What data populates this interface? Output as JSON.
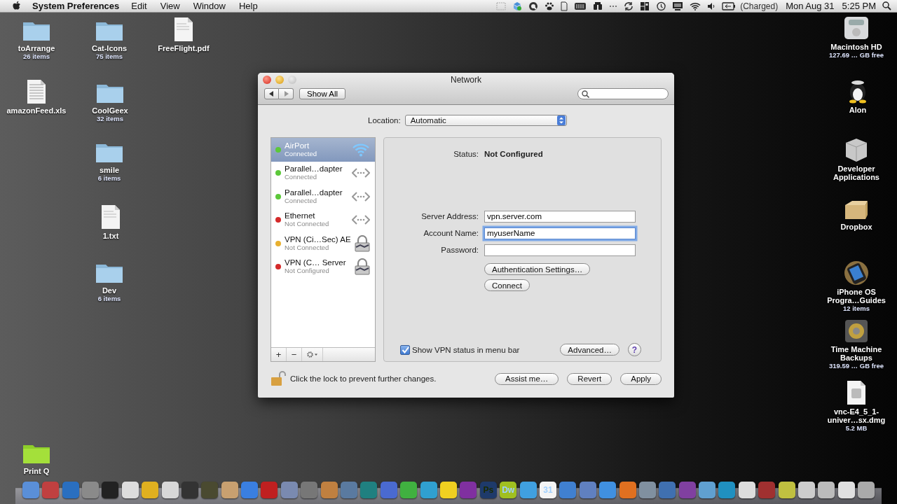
{
  "menu_bar": {
    "app_name": "System Preferences",
    "menus": [
      "Edit",
      "View",
      "Window",
      "Help"
    ],
    "battery_status": "(Charged)",
    "date": "Mon Aug 31",
    "time": "5:25 PM"
  },
  "desktop_icons": [
    {
      "kind": "folder",
      "name": "toArrange",
      "info": "26 items"
    },
    {
      "kind": "folder",
      "name": "Cat-Icons",
      "info": "75 items"
    },
    {
      "kind": "document",
      "name": "FreeFlight.pdf"
    },
    {
      "kind": "spreadsheet",
      "name": "amazonFeed.xls"
    },
    {
      "kind": "folder",
      "name": "CoolGeex",
      "info": "32 items"
    },
    {
      "kind": "folder",
      "name": "smile",
      "info": "6 items"
    },
    {
      "kind": "document",
      "name": "1.txt"
    },
    {
      "kind": "folder",
      "name": "Dev",
      "info": "6 items"
    },
    {
      "kind": "drive",
      "name": "Macintosh HD",
      "info": "127.69 … GB free"
    },
    {
      "kind": "penguin",
      "name": "Alon"
    },
    {
      "kind": "cube",
      "name": "Developer Applications"
    },
    {
      "kind": "box",
      "name": "Dropbox"
    },
    {
      "kind": "phone",
      "name": "iPhone OS Progra…Guides",
      "info": "12 items"
    },
    {
      "kind": "backup",
      "name": "Time Machine Backups",
      "info": "319.59 … GB free"
    },
    {
      "kind": "diskimage",
      "name": "vnc-E4_5_1-univer…sx.dmg",
      "info": "5.2 MB"
    },
    {
      "kind": "greenfolder",
      "name": "Print Q"
    }
  ],
  "window": {
    "title": "Network",
    "show_all": "Show All"
  },
  "location": {
    "label": "Location:",
    "value": "Automatic"
  },
  "services": [
    {
      "name": "AirPort",
      "status": "Connected",
      "color": "#5cc83a",
      "kind": "wifi",
      "selected": true
    },
    {
      "name": "Parallel…dapter",
      "status": "Connected",
      "color": "#5cc83a",
      "kind": "wired",
      "selected": false
    },
    {
      "name": "Parallel…dapter",
      "status": "Connected",
      "color": "#5cc83a",
      "kind": "wired",
      "selected": false
    },
    {
      "name": "Ethernet",
      "status": "Not Connected",
      "color": "#d42a2a",
      "kind": "wired",
      "selected": false
    },
    {
      "name": "VPN (Ci…Sec) AE",
      "status": "Not Connected",
      "color": "#e8b030",
      "kind": "vpn",
      "selected": false
    },
    {
      "name": "VPN (C… Server",
      "status": "Not Configured",
      "color": "#d42a2a",
      "kind": "vpn",
      "selected": false
    }
  ],
  "list_buttons": [
    "+",
    "−"
  ],
  "detail": {
    "status_label": "Status:",
    "status_value": "Not Configured",
    "fields": [
      {
        "label": "Server Address:",
        "value": "vpn.server.com",
        "focused": false
      },
      {
        "label": "Account Name:",
        "value": "myuserName",
        "focused": true
      },
      {
        "label": "Password:",
        "focused": false
      }
    ],
    "buttons": [
      "Authentication Settings…",
      "Connect"
    ],
    "show_vpn_status": {
      "label": "Show VPN status in menu bar",
      "checked": true
    },
    "advanced": "Advanced…",
    "help": "?"
  },
  "footer": {
    "lock_text": "Click the lock to prevent further changes.",
    "buttons": [
      "Assist me…",
      "Revert",
      "Apply"
    ]
  },
  "dock": [
    {
      "kind": "app",
      "color": "#5a8fd8"
    },
    {
      "kind": "app",
      "color": "#c04040"
    },
    {
      "kind": "app",
      "color": "#2a6fc0"
    },
    {
      "kind": "app",
      "color": "#8a8a8a"
    },
    {
      "kind": "app",
      "color": "#222222"
    },
    {
      "kind": "app",
      "color": "#dddddd"
    },
    {
      "kind": "app",
      "color": "#e0b020"
    },
    {
      "kind": "app",
      "color": "#d8d8d8"
    },
    {
      "kind": "app",
      "color": "#333333"
    },
    {
      "kind": "app",
      "color": "#4a4a30"
    },
    {
      "kind": "app",
      "color": "#c8a070"
    },
    {
      "kind": "app",
      "color": "#3a7fe0"
    },
    {
      "kind": "app",
      "color": "#c02020"
    },
    {
      "kind": "app",
      "color": "#7a8ab0"
    },
    {
      "kind": "app",
      "color": "#777777"
    },
    {
      "kind": "app",
      "color": "#c08040"
    },
    {
      "kind": "app",
      "color": "#5a7aa0"
    },
    {
      "kind": "app",
      "color": "#208080"
    },
    {
      "kind": "app",
      "color": "#4a6ad0"
    },
    {
      "kind": "app",
      "color": "#40b040"
    },
    {
      "kind": "app",
      "color": "#30a0d0"
    },
    {
      "kind": "app",
      "color": "#f0d020"
    },
    {
      "kind": "app",
      "color": "#8030a0"
    },
    {
      "kind": "label",
      "color": "#1e3a6a",
      "label": "Ps"
    },
    {
      "kind": "label",
      "color": "#a0c020",
      "label": "Dw"
    },
    {
      "kind": "app",
      "color": "#40a0e0"
    },
    {
      "kind": "label",
      "color": "#f4f4f4",
      "label": "31"
    },
    {
      "kind": "app",
      "color": "#4080d0"
    },
    {
      "kind": "app",
      "color": "#6080c0"
    },
    {
      "kind": "app",
      "color": "#4090e0"
    },
    {
      "kind": "app",
      "color": "#e07020"
    },
    {
      "kind": "app",
      "color": "#8090a0"
    },
    {
      "kind": "app",
      "color": "#4070b0"
    },
    {
      "kind": "app",
      "color": "#8040a0"
    },
    {
      "kind": "app",
      "color": "#60a0d0"
    },
    {
      "kind": "app",
      "color": "#2090c0"
    },
    {
      "kind": "app",
      "color": "#dddddd"
    },
    {
      "kind": "app",
      "color": "#a03030"
    },
    {
      "kind": "app",
      "color": "#c0c040"
    },
    {
      "kind": "app",
      "color": "#cccccc"
    },
    {
      "kind": "app",
      "color": "#bbbbbb"
    },
    {
      "kind": "app",
      "color": "#e0e0e0"
    },
    {
      "kind": "app",
      "color": "#aaaaaa"
    }
  ]
}
